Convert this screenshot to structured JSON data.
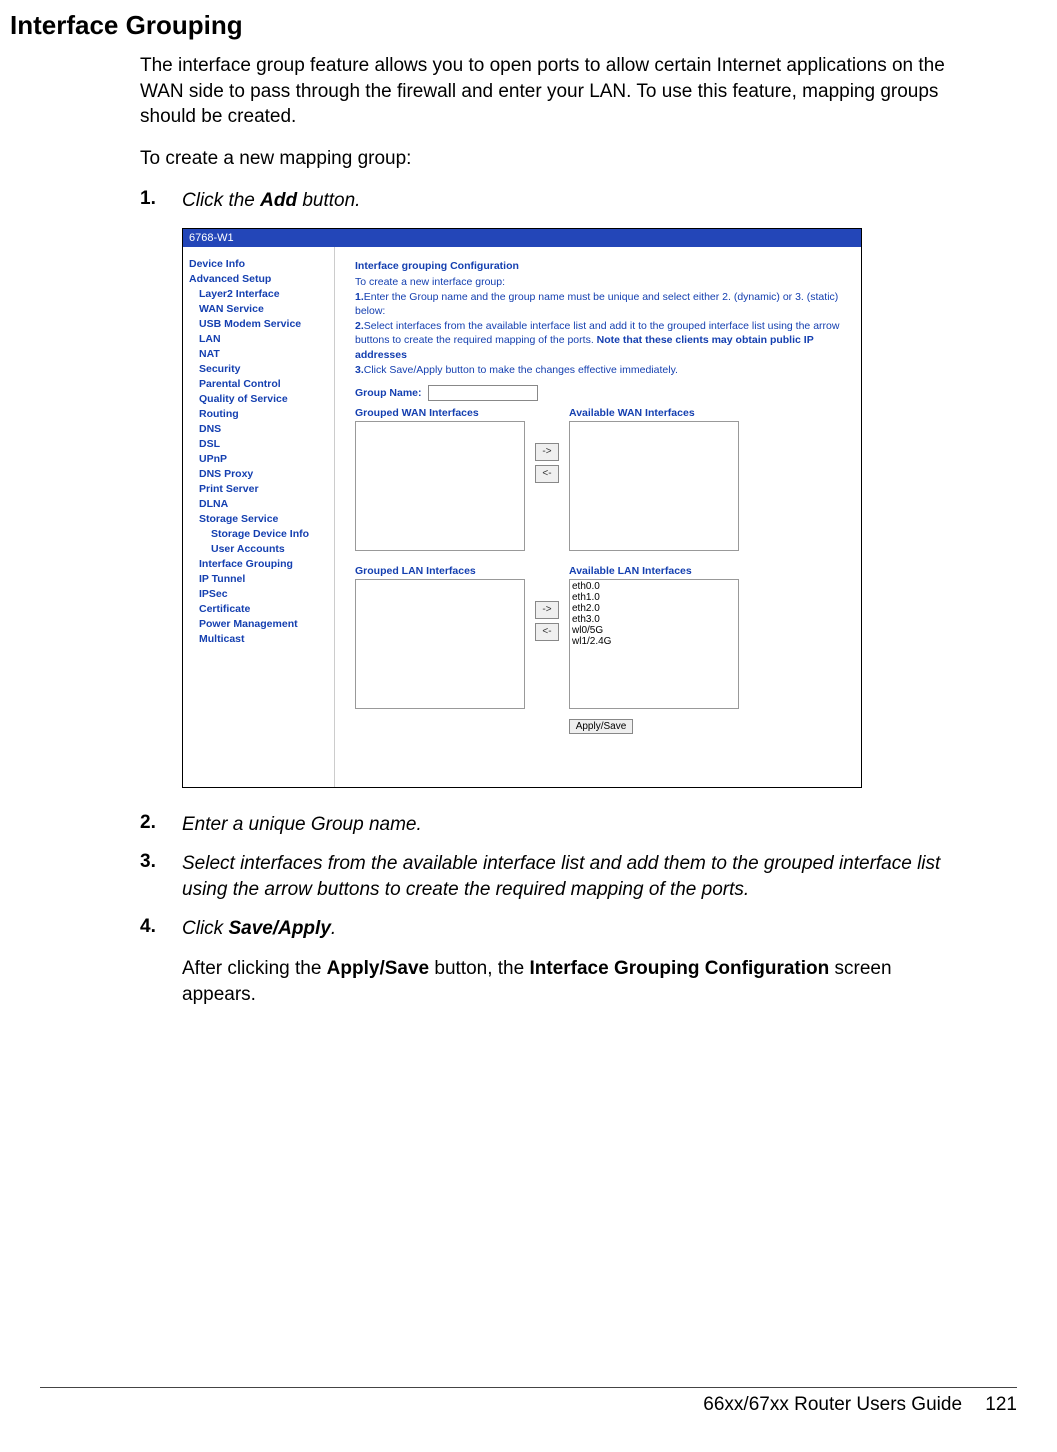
{
  "doc": {
    "section_title": "Interface Grouping",
    "intro": "The interface group feature allows you to open ports to allow certain Internet applications on the WAN side to pass through the firewall and enter your LAN. To use this feature, mapping groups should be created.",
    "lead": "To create a new mapping group:",
    "steps": {
      "s1_num": "1.",
      "s1_pre": "Click the ",
      "s1_bold": "Add",
      "s1_post": " button.",
      "s2_num": "2.",
      "s2_txt": "Enter a unique Group name.",
      "s3_num": "3.",
      "s3_txt": "Select interfaces from the available interface list and add them to the grouped interface list using the arrow buttons to create the required mapping of the ports.",
      "s4_num": "4.",
      "s4_pre": "Click ",
      "s4_bold": "Save/Apply",
      "s4_post": "."
    },
    "after_pre": "After clicking the ",
    "after_b1": "Apply/Save",
    "after_mid": " button, the ",
    "after_b2": "Interface Grouping Configuration",
    "after_post": " screen appears.",
    "footer_guide": "66xx/67xx Router Users Guide",
    "footer_page": "121"
  },
  "router": {
    "title": "6768-W1",
    "nav": {
      "device_info": "Device Info",
      "advanced": "Advanced Setup",
      "l2": "Layer2 Interface",
      "wan": "WAN Service",
      "usb": "USB Modem Service",
      "lan": "LAN",
      "nat": "NAT",
      "security": "Security",
      "parental": "Parental Control",
      "qos": "Quality of Service",
      "routing": "Routing",
      "dns": "DNS",
      "dsl": "DSL",
      "upnp": "UPnP",
      "dnsproxy": "DNS Proxy",
      "print": "Print Server",
      "dlna": "DLNA",
      "storage": "Storage Service",
      "storage_dev": "Storage Device Info",
      "user_acc": "User Accounts",
      "ifgrp": "Interface Grouping",
      "iptunnel": "IP Tunnel",
      "ipsec": "IPSec",
      "cert": "Certificate",
      "power": "Power Management",
      "multicast": "Multicast"
    },
    "main": {
      "title": "Interface grouping Configuration",
      "sub": "To create a new interface group:",
      "p1_num": "1.",
      "p1": "Enter the Group name and the group name must be unique and select either 2. (dynamic) or 3. (static) below:",
      "p2_num": "2.",
      "p2a": "Select interfaces from the available interface list and add it to the grouped interface list using the arrow buttons to create the required mapping of the ports. ",
      "p2b": "Note that these clients may obtain public IP addresses",
      "p3_num": "3.",
      "p3": "Click Save/Apply button to make the changes effective immediately.",
      "group_label": "Group Name:",
      "grp_wan": "Grouped WAN Interfaces",
      "avail_wan": "Available WAN Interfaces",
      "grp_lan": "Grouped LAN Interfaces",
      "avail_lan": "Available LAN Interfaces",
      "arrow_right": "->",
      "arrow_left": "<-",
      "apply": "Apply/Save",
      "lan_opts": {
        "o0": "eth0.0",
        "o1": "eth1.0",
        "o2": "eth2.0",
        "o3": "eth3.0",
        "o4": "wl0/5G",
        "o5": "wl1/2.4G"
      }
    }
  }
}
